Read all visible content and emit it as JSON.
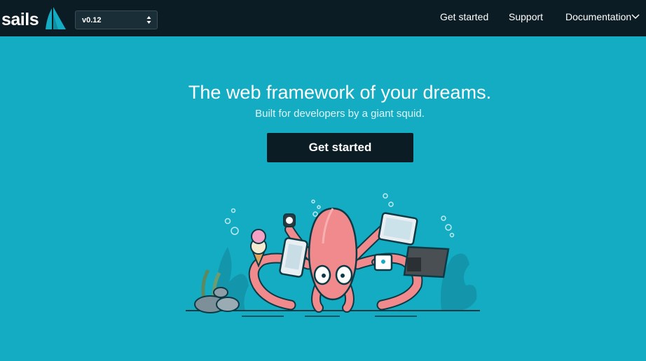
{
  "brand": {
    "name": "sails"
  },
  "version_select": {
    "value": "v0.12"
  },
  "nav": {
    "items": [
      {
        "label": "Get started"
      },
      {
        "label": "Support"
      },
      {
        "label": "Documentation"
      }
    ]
  },
  "hero": {
    "title": "The web framework of your dreams.",
    "subtitle": "Built for developers by a giant squid.",
    "cta_label": "Get started"
  },
  "colors": {
    "background": "#14acc2",
    "topbar": "#0b1c24",
    "squid": "#f08a8c"
  },
  "icons": {
    "logo": "sail-icon",
    "select_caret": "sort-arrows-icon",
    "dropdown": "chevron-down-icon"
  }
}
